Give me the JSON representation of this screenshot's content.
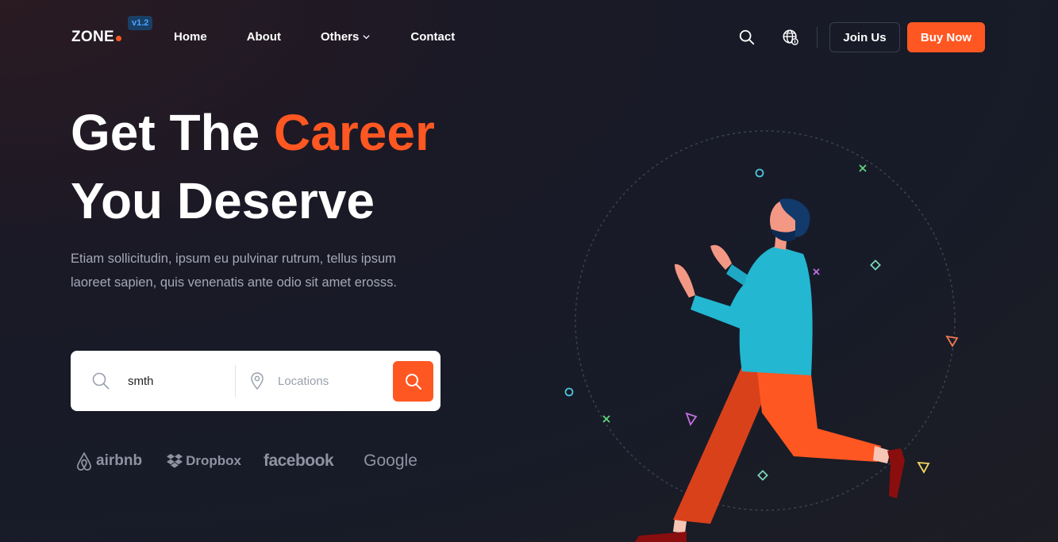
{
  "header": {
    "logo": "ZONE",
    "version": "v1.2",
    "nav": [
      {
        "label": "Home"
      },
      {
        "label": "About"
      },
      {
        "label": "Others",
        "has_dropdown": true
      },
      {
        "label": "Contact"
      }
    ],
    "icons": [
      "search-icon",
      "globe-icon"
    ],
    "join_label": "Join Us",
    "buy_label": "Buy Now"
  },
  "hero": {
    "title_line1_start": "Get The",
    "title_line1_accent": "Career",
    "title_line2": "You Deserve",
    "description": "Etiam sollicitudin, ipsum eu pulvinar rutrum, tellus ipsum laoreet sapien, quis venenatis ante odio sit amet erosss."
  },
  "search": {
    "keyword_value": "smth",
    "location_placeholder": "Locations"
  },
  "brands": [
    "airbnb",
    "Dropbox",
    "facebook",
    "Google"
  ],
  "colors": {
    "accent": "#ff5722",
    "background": "#171b28",
    "muted_text": "#a3a8b8"
  }
}
